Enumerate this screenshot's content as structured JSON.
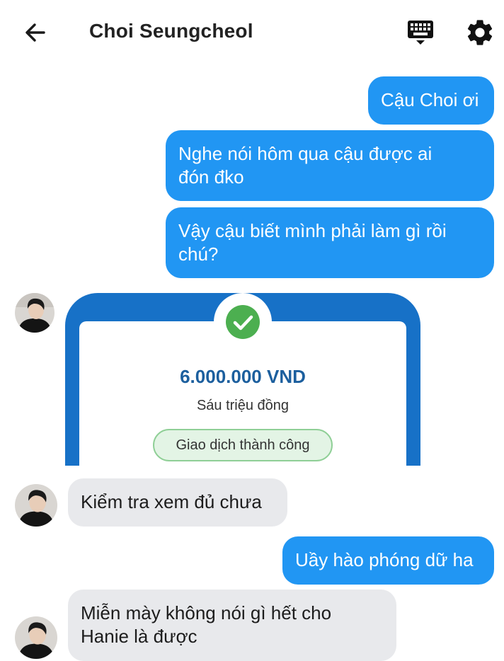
{
  "header": {
    "title": "Choi Seungcheol"
  },
  "messages": {
    "m1": "Cậu Choi ơi",
    "m2_line1": "Nghe nói hôm qua cậu được ai",
    "m2_line2": "đón đko",
    "m3_line1": "Vậy cậu biết mình phải làm gì rồi",
    "m3_line2": "chú?",
    "m5": "Kiểm tra xem đủ chưa",
    "m6": "Uầy hào phóng dữ ha",
    "m7_line1": "Miễn mày không nói gì hết cho",
    "m7_line2": "Hanie là được"
  },
  "transfer": {
    "amount": "6.000.000 VND",
    "amount_words": "Sáu triệu đồng",
    "status": "Giao dịch thành công"
  },
  "colors": {
    "outgoing_bubble": "#2196f3",
    "incoming_bubble": "#e8e9ec",
    "card_frame": "#1771c7",
    "success": "#4caf50"
  },
  "icons": [
    "back-arrow-icon",
    "keyboard-icon",
    "gear-icon",
    "check-icon"
  ]
}
